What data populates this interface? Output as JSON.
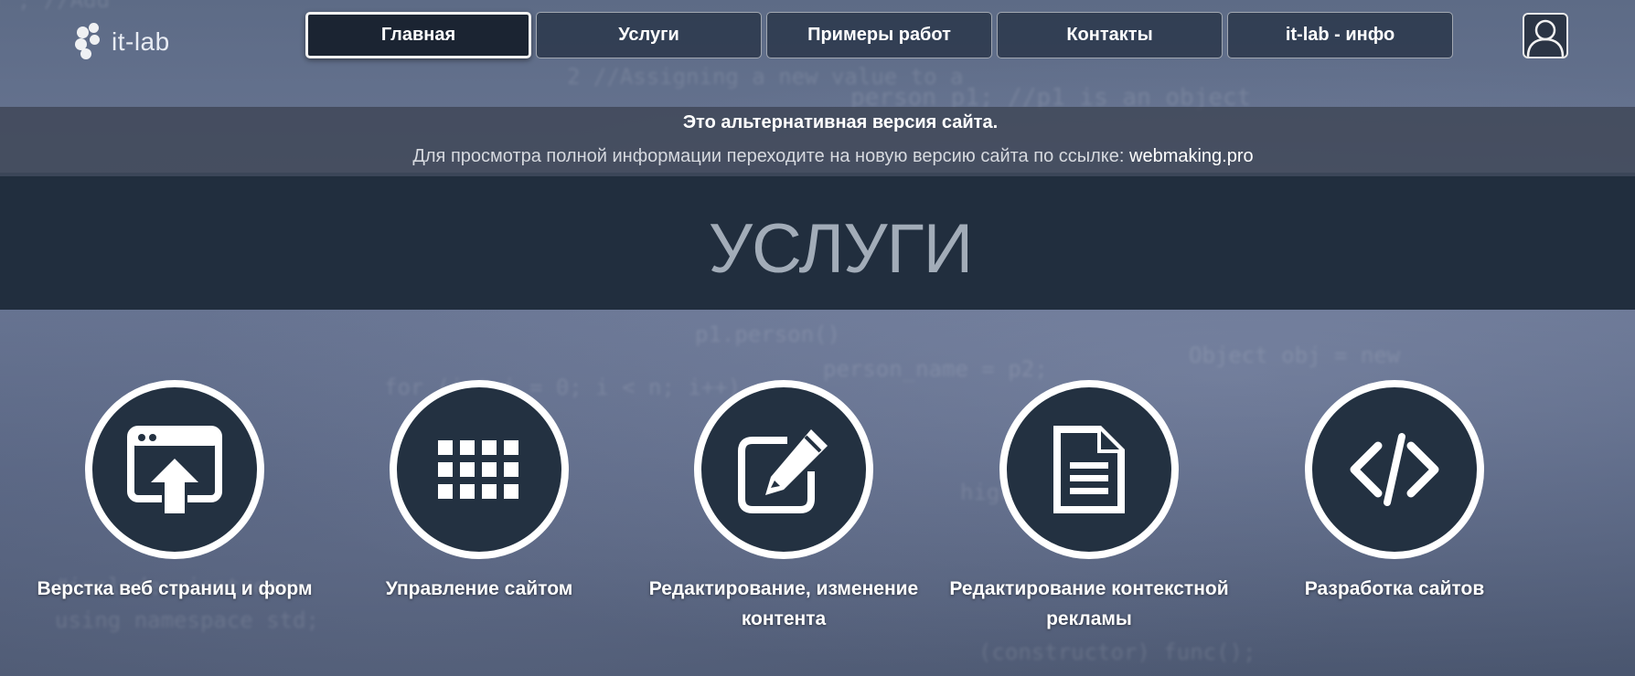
{
  "logo": {
    "text": "it-lab"
  },
  "nav": {
    "items": [
      {
        "label": "Главная",
        "active": true
      },
      {
        "label": "Услуги"
      },
      {
        "label": "Примеры работ"
      },
      {
        "label": "Контакты"
      },
      {
        "label": "it-lab - инфо"
      }
    ]
  },
  "user": {
    "icon": "user-icon"
  },
  "notice": {
    "title": "Это альтернативная версия сайта.",
    "text": "Для просмотра полной информации переходите на новую версию сайта по ссылке: ",
    "link": "webmaking.pro"
  },
  "banner": {
    "title": "УСЛУГИ"
  },
  "services": [
    {
      "label": "Верстка веб страниц и форм",
      "icon": "web-upload-icon"
    },
    {
      "label": "Управление сайтом",
      "icon": "grid-icon"
    },
    {
      "label": "Редактирование, изменение контента",
      "icon": "edit-icon"
    },
    {
      "label": "Редактирование контекстной рекламы",
      "icon": "document-icon"
    },
    {
      "label": "Разработка сайтов",
      "icon": "code-icon"
    }
  ],
  "colors": {
    "nav_bg": "#2c394c",
    "nav_active_bg": "#1b2432",
    "banner_bg": "#212e3e",
    "banner_text": "#a2acb8",
    "circle_bg": "#233141"
  }
}
